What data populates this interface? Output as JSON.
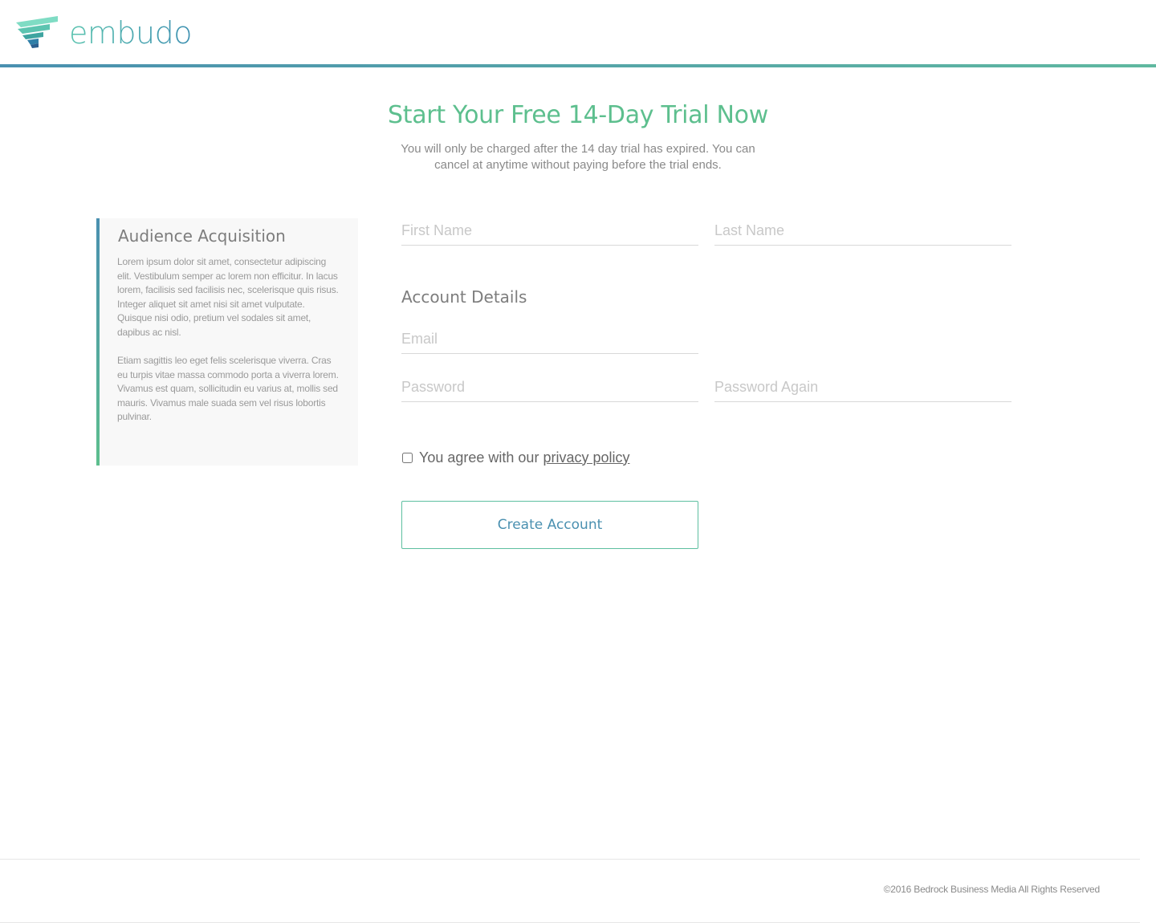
{
  "header": {
    "logo_text": "embudo"
  },
  "hero": {
    "title": "Start Your Free 14-Day Trial Now",
    "subtitle": "You will only be charged after the 14 day trial has expired. You can cancel at anytime without paying before the trial ends."
  },
  "info_card": {
    "title": "Audience Acquisition",
    "paragraph_1": "Lorem ipsum dolor sit amet, consectetur adipiscing elit. Vestibulum semper ac lorem non efficitur. In lacus lorem, facilisis sed facilisis nec, scelerisque quis risus. Integer aliquet sit amet nisi sit amet vulputate. Quisque nisi odio, pretium vel sodales sit amet, dapibus ac nisl.",
    "paragraph_2": "Etiam sagittis leo eget felis scelerisque viverra. Cras eu turpis vitae massa commodo porta a viverra lorem. Vivamus est quam, sollicitudin eu varius at, mollis sed mauris. Vivamus male suada sem vel risus lobortis pulvinar."
  },
  "form": {
    "first_name": {
      "placeholder": "First Name",
      "value": ""
    },
    "last_name": {
      "placeholder": "Last Name",
      "value": ""
    },
    "section_title": "Account Details",
    "email": {
      "placeholder": "Email",
      "value": ""
    },
    "password": {
      "placeholder": "Password",
      "value": ""
    },
    "password_again": {
      "placeholder": "Password Again",
      "value": ""
    },
    "agree_text": "You agree with our",
    "privacy_link": "privacy policy",
    "agree_checked": false,
    "submit_label": "Create Account"
  },
  "footer": {
    "copyright": "©2016 Bedrock Business Media All Rights Reserved"
  },
  "colors": {
    "accent_green": "#5dbf8e",
    "accent_blue": "#4a90b0",
    "logo_teal": "#5cc4b0"
  },
  "icons": {
    "logo": "embudo-funnel-logo-icon"
  }
}
